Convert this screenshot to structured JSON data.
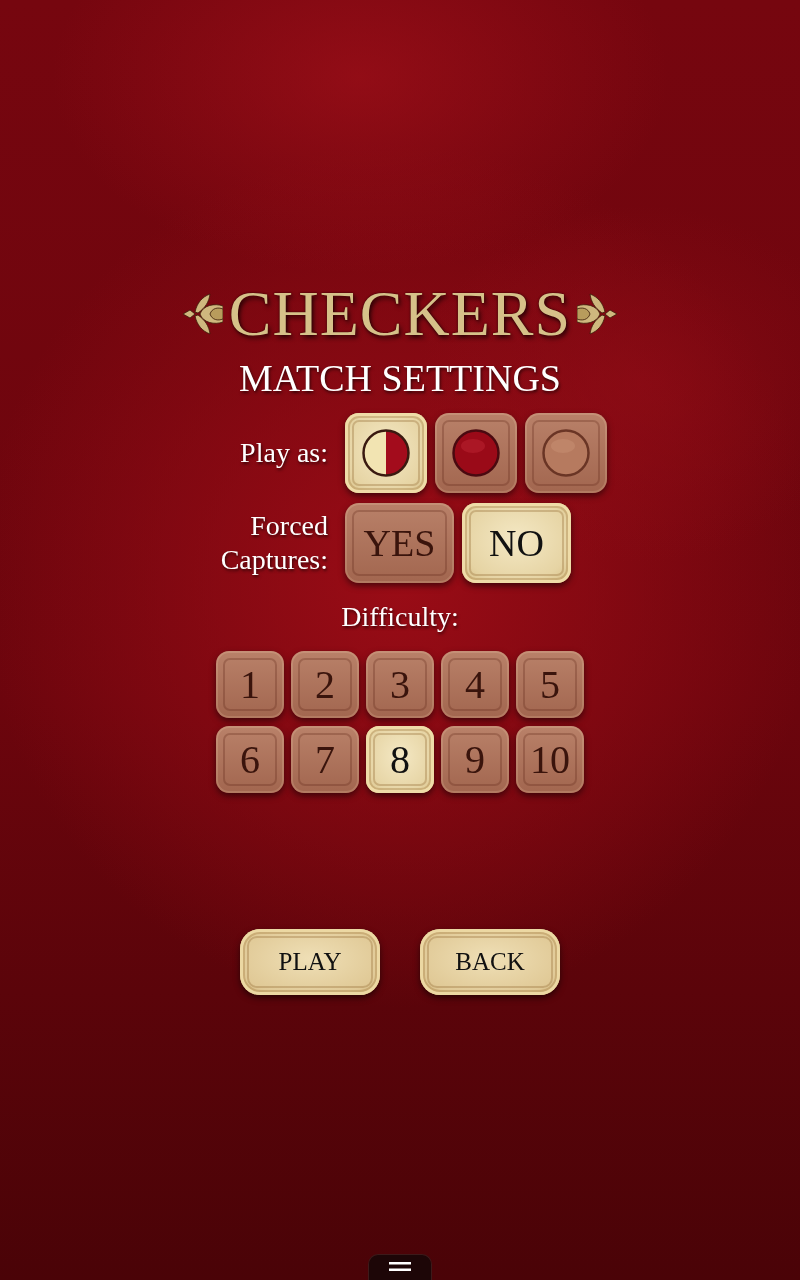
{
  "title": "CHECKERS",
  "subtitle": "MATCH SETTINGS",
  "play_as": {
    "label": "Play as:",
    "options": [
      {
        "kind": "split",
        "selected": true
      },
      {
        "kind": "red",
        "selected": false
      },
      {
        "kind": "tan",
        "selected": false
      }
    ]
  },
  "forced_captures": {
    "label": "Forced Captures:",
    "options": [
      {
        "label": "YES",
        "selected": false
      },
      {
        "label": "NO",
        "selected": true
      }
    ]
  },
  "difficulty": {
    "label": "Difficulty:",
    "levels": [
      {
        "label": "1",
        "selected": false
      },
      {
        "label": "2",
        "selected": false
      },
      {
        "label": "3",
        "selected": false
      },
      {
        "label": "4",
        "selected": false
      },
      {
        "label": "5",
        "selected": false
      },
      {
        "label": "6",
        "selected": false
      },
      {
        "label": "7",
        "selected": false
      },
      {
        "label": "8",
        "selected": true
      },
      {
        "label": "9",
        "selected": false
      },
      {
        "label": "10",
        "selected": false
      }
    ]
  },
  "buttons": [
    {
      "label": "PLAY"
    },
    {
      "label": "BACK"
    }
  ]
}
